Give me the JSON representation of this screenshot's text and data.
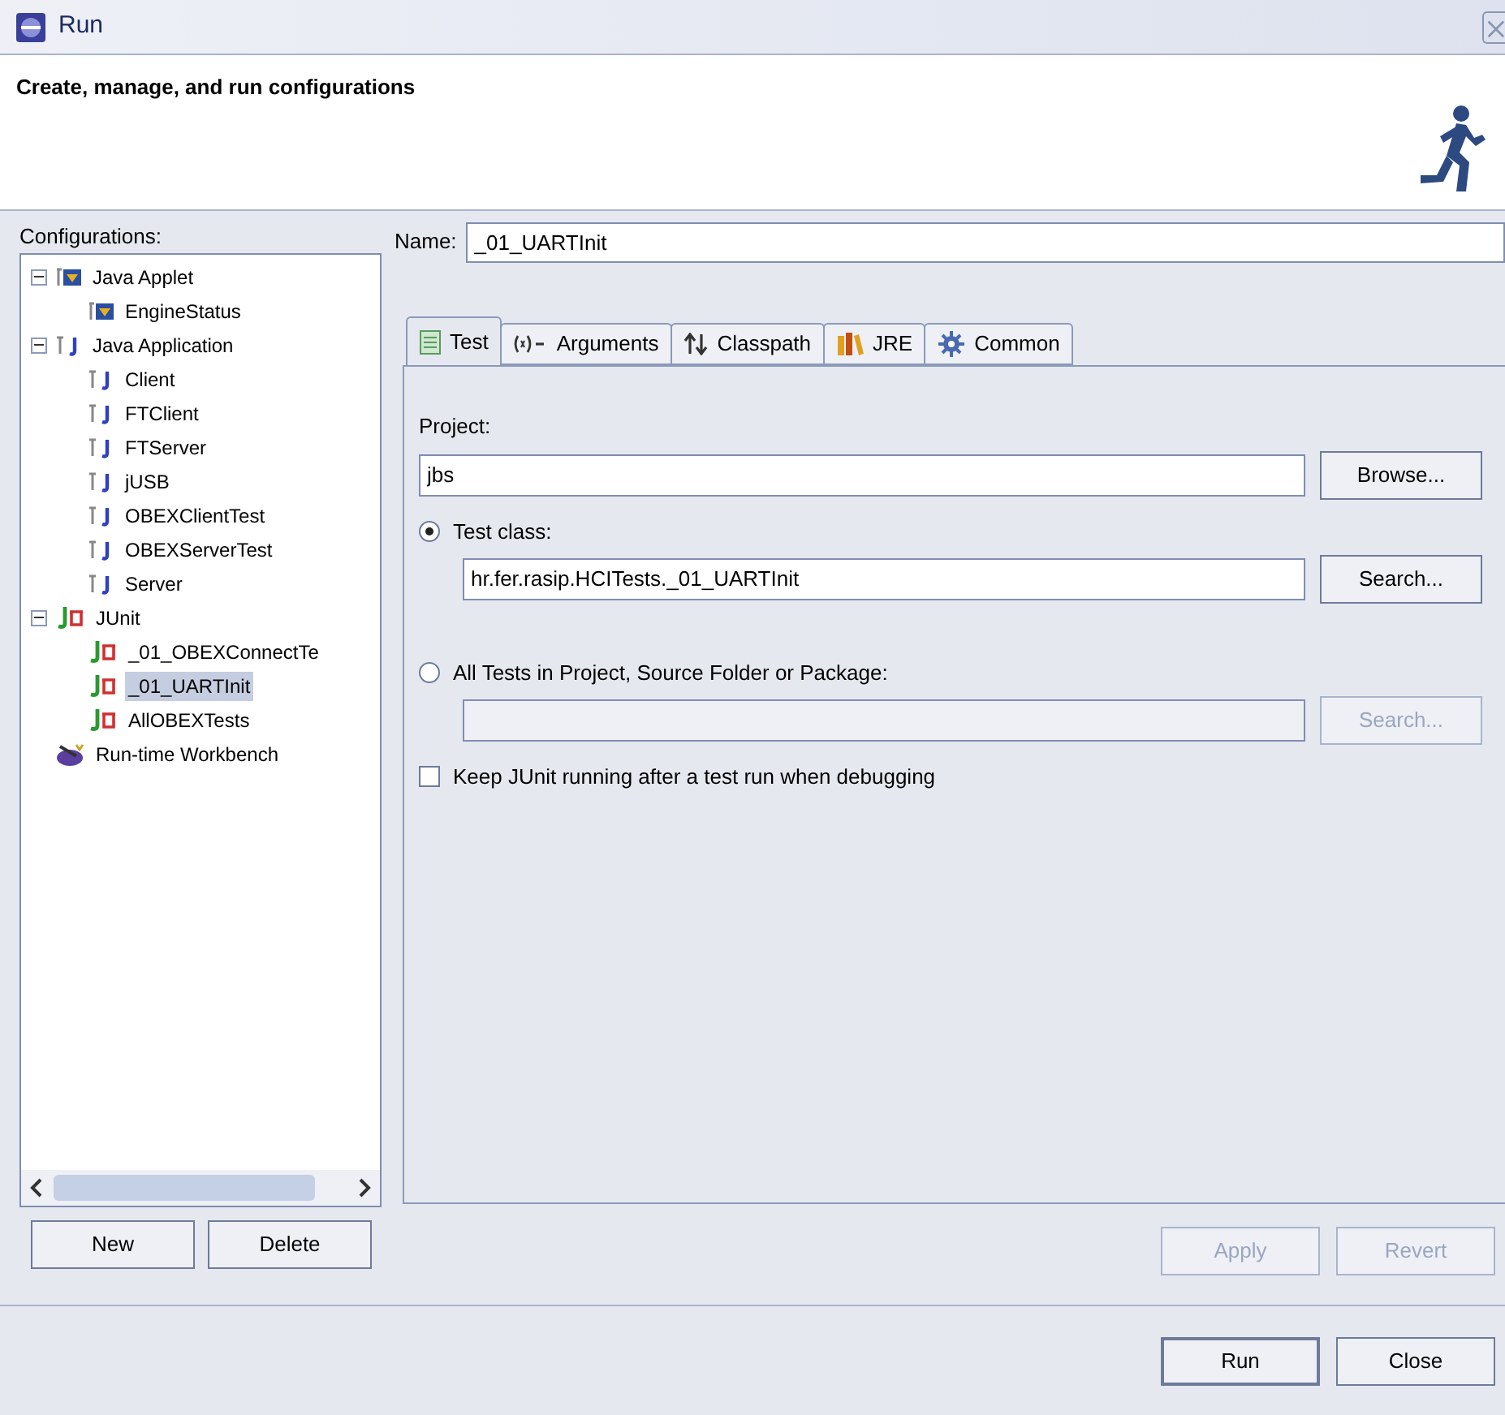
{
  "window": {
    "title": "Run"
  },
  "header": {
    "message": "Create, manage, and run configurations"
  },
  "configurations": {
    "label": "Configurations:",
    "tree": [
      {
        "label": "Java Applet",
        "kind": "applet",
        "expanded": true,
        "selected": false,
        "children": [
          {
            "label": "EngineStatus",
            "kind": "applet",
            "selected": false
          }
        ]
      },
      {
        "label": "Java Application",
        "kind": "app",
        "expanded": true,
        "selected": false,
        "children": [
          {
            "label": "Client",
            "kind": "app",
            "selected": false
          },
          {
            "label": "FTClient",
            "kind": "app",
            "selected": false
          },
          {
            "label": "FTServer",
            "kind": "app",
            "selected": false
          },
          {
            "label": "jUSB",
            "kind": "app",
            "selected": false
          },
          {
            "label": "OBEXClientTest",
            "kind": "app",
            "selected": false
          },
          {
            "label": "OBEXServerTest",
            "kind": "app",
            "selected": false
          },
          {
            "label": "Server",
            "kind": "app",
            "selected": false
          }
        ]
      },
      {
        "label": "JUnit",
        "kind": "junit",
        "expanded": true,
        "selected": false,
        "children": [
          {
            "label": "_01_OBEXConnectTe",
            "kind": "junit",
            "selected": false
          },
          {
            "label": "_01_UARTInit",
            "kind": "junit",
            "selected": true
          },
          {
            "label": "AllOBEXTests",
            "kind": "junit",
            "selected": false
          }
        ]
      },
      {
        "label": "Run-time Workbench",
        "kind": "workbench",
        "selected": false
      }
    ],
    "buttons": [
      {
        "label": "New",
        "disabled": false
      },
      {
        "label": "Delete",
        "disabled": false
      }
    ]
  },
  "name_field": {
    "label": "Name:",
    "value": "_01_UARTInit"
  },
  "tabs": [
    {
      "label": "Test",
      "kind": "test",
      "selected": true
    },
    {
      "label": "Arguments",
      "kind": "arguments",
      "selected": false
    },
    {
      "label": "Classpath",
      "kind": "classpath",
      "selected": false
    },
    {
      "label": "JRE",
      "kind": "jre",
      "selected": false
    },
    {
      "label": "Common",
      "kind": "common",
      "selected": false
    }
  ],
  "project": {
    "label": "Project:",
    "value": "jbs",
    "button": {
      "label": "Browse...",
      "disabled": false
    }
  },
  "test_options": [
    {
      "label": "Test class:",
      "selected": true,
      "value": "hr.fer.rasip.HCITests._01_UARTInit",
      "disabled": false,
      "button": {
        "label": "Search...",
        "disabled": false
      }
    },
    {
      "label": "All Tests in Project, Source Folder or Package:",
      "selected": false,
      "disabled": true,
      "button": {
        "label": "Search...",
        "disabled": true
      }
    }
  ],
  "keep_running": {
    "label": "Keep JUnit running after a test run when debugging",
    "checked": false
  },
  "panel_buttons": [
    {
      "label": "Apply",
      "disabled": true
    },
    {
      "label": "Revert",
      "disabled": true
    }
  ],
  "dialog_buttons": [
    {
      "label": "Run",
      "disabled": false,
      "default": true
    },
    {
      "label": "Close",
      "disabled": false,
      "default": false
    }
  ]
}
